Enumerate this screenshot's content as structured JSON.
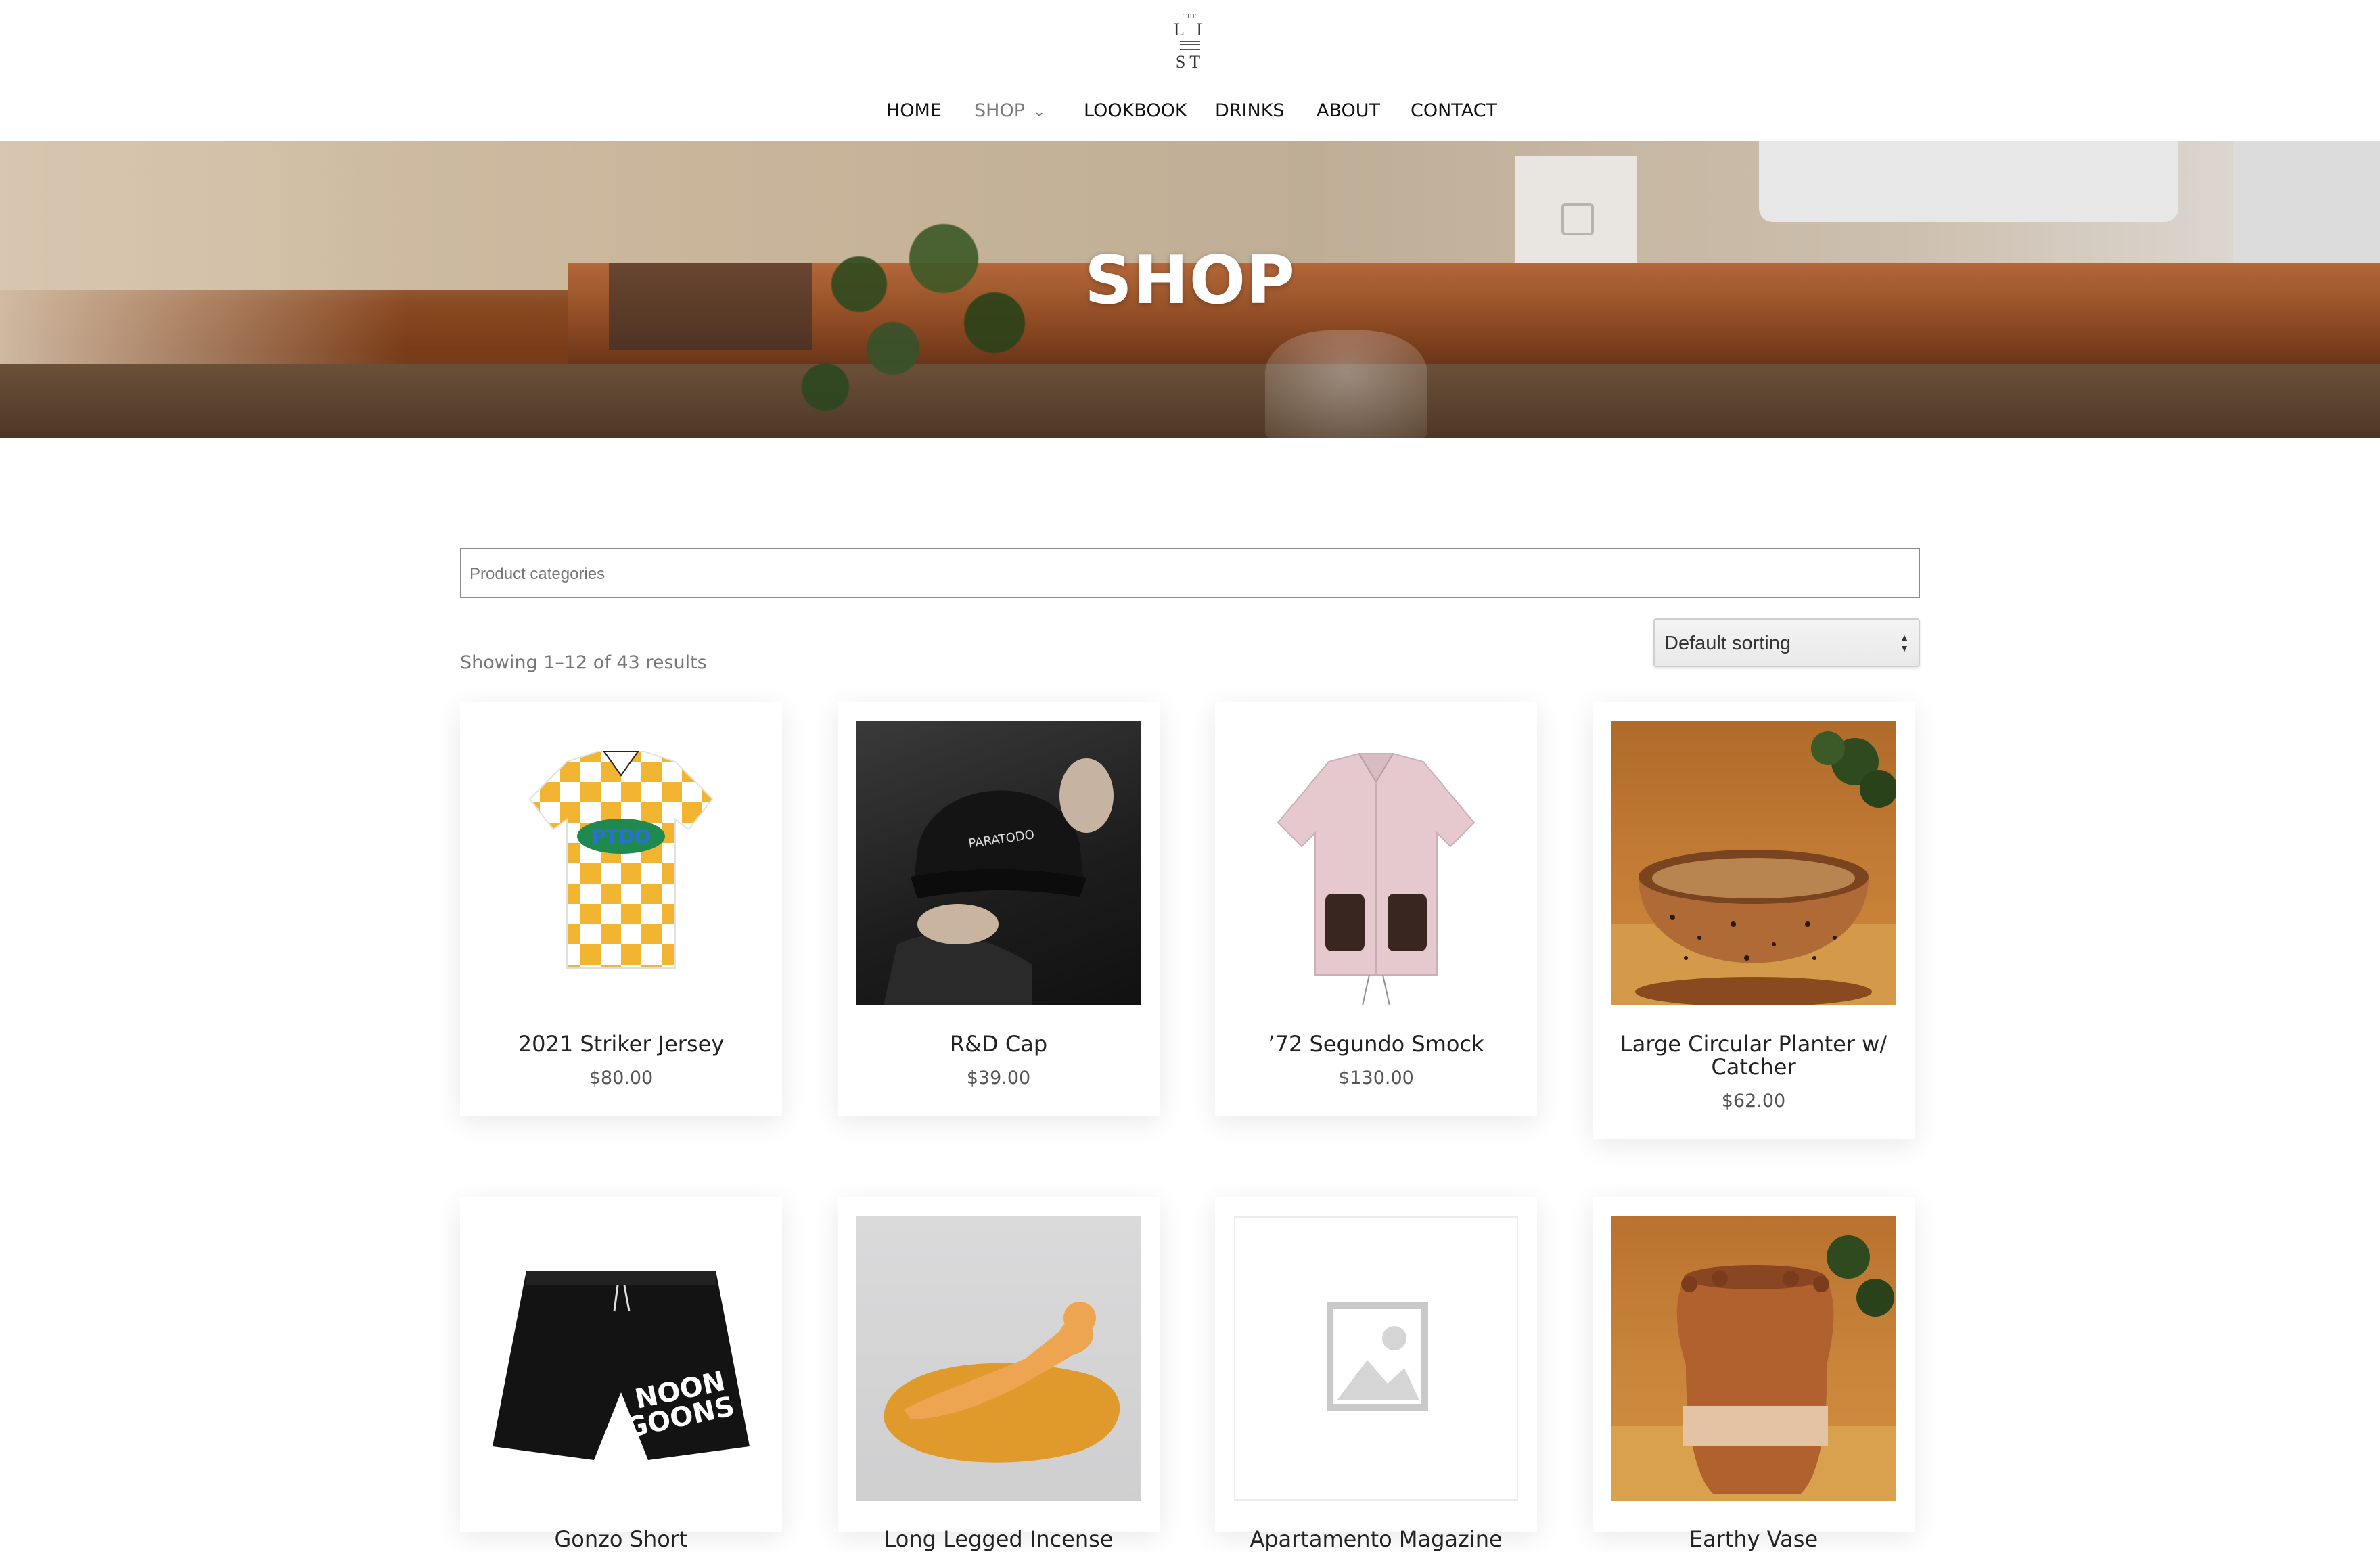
{
  "logo": {
    "top": "THE",
    "line1": "L I",
    "line2": "ST"
  },
  "nav": {
    "items": [
      {
        "label": "HOME"
      },
      {
        "label": "SHOP"
      },
      {
        "label": "LOOKBOOK"
      },
      {
        "label": "DRINKS"
      },
      {
        "label": "ABOUT"
      },
      {
        "label": "CONTACT"
      }
    ]
  },
  "hero": {
    "title": "SHOP"
  },
  "filters": {
    "categories_placeholder": "Product categories",
    "result_count": "Showing 1–12 of 43 results",
    "sort_selected": "Default sorting"
  },
  "products": [
    {
      "title": "2021 Striker Jersey",
      "price": "$80.00",
      "image": "jersey"
    },
    {
      "title": "R&D Cap",
      "price": "$39.00",
      "image": "cap"
    },
    {
      "title": "’72 Segundo Smock",
      "price": "$130.00",
      "image": "smock"
    },
    {
      "title": "Large Circular Planter w/ Catcher",
      "price": "$62.00",
      "image": "planter"
    },
    {
      "title": "Gonzo Short",
      "price": "",
      "image": "shorts"
    },
    {
      "title": "Long Legged Incense",
      "price": "",
      "image": "incense"
    },
    {
      "title": "Apartamento Magazine",
      "price": "",
      "image": "placeholder-image"
    },
    {
      "title": "Earthy Vase",
      "price": "",
      "image": "vase"
    }
  ],
  "icons": {
    "chevron": "chevron-down-icon",
    "sort_arrows": "sort-arrows-icon",
    "placeholder": "image-placeholder-icon"
  }
}
